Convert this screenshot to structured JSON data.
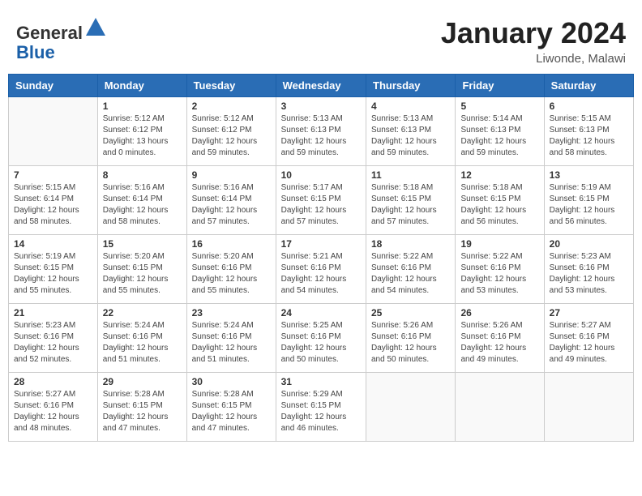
{
  "header": {
    "logo_line1": "General",
    "logo_line2": "Blue",
    "month_year": "January 2024",
    "location": "Liwonde, Malawi"
  },
  "days_of_week": [
    "Sunday",
    "Monday",
    "Tuesday",
    "Wednesday",
    "Thursday",
    "Friday",
    "Saturday"
  ],
  "weeks": [
    [
      {
        "day": "",
        "info": ""
      },
      {
        "day": "1",
        "info": "Sunrise: 5:12 AM\nSunset: 6:12 PM\nDaylight: 13 hours\nand 0 minutes."
      },
      {
        "day": "2",
        "info": "Sunrise: 5:12 AM\nSunset: 6:12 PM\nDaylight: 12 hours\nand 59 minutes."
      },
      {
        "day": "3",
        "info": "Sunrise: 5:13 AM\nSunset: 6:13 PM\nDaylight: 12 hours\nand 59 minutes."
      },
      {
        "day": "4",
        "info": "Sunrise: 5:13 AM\nSunset: 6:13 PM\nDaylight: 12 hours\nand 59 minutes."
      },
      {
        "day": "5",
        "info": "Sunrise: 5:14 AM\nSunset: 6:13 PM\nDaylight: 12 hours\nand 59 minutes."
      },
      {
        "day": "6",
        "info": "Sunrise: 5:15 AM\nSunset: 6:13 PM\nDaylight: 12 hours\nand 58 minutes."
      }
    ],
    [
      {
        "day": "7",
        "info": "Sunrise: 5:15 AM\nSunset: 6:14 PM\nDaylight: 12 hours\nand 58 minutes."
      },
      {
        "day": "8",
        "info": "Sunrise: 5:16 AM\nSunset: 6:14 PM\nDaylight: 12 hours\nand 58 minutes."
      },
      {
        "day": "9",
        "info": "Sunrise: 5:16 AM\nSunset: 6:14 PM\nDaylight: 12 hours\nand 57 minutes."
      },
      {
        "day": "10",
        "info": "Sunrise: 5:17 AM\nSunset: 6:15 PM\nDaylight: 12 hours\nand 57 minutes."
      },
      {
        "day": "11",
        "info": "Sunrise: 5:18 AM\nSunset: 6:15 PM\nDaylight: 12 hours\nand 57 minutes."
      },
      {
        "day": "12",
        "info": "Sunrise: 5:18 AM\nSunset: 6:15 PM\nDaylight: 12 hours\nand 56 minutes."
      },
      {
        "day": "13",
        "info": "Sunrise: 5:19 AM\nSunset: 6:15 PM\nDaylight: 12 hours\nand 56 minutes."
      }
    ],
    [
      {
        "day": "14",
        "info": "Sunrise: 5:19 AM\nSunset: 6:15 PM\nDaylight: 12 hours\nand 55 minutes."
      },
      {
        "day": "15",
        "info": "Sunrise: 5:20 AM\nSunset: 6:15 PM\nDaylight: 12 hours\nand 55 minutes."
      },
      {
        "day": "16",
        "info": "Sunrise: 5:20 AM\nSunset: 6:16 PM\nDaylight: 12 hours\nand 55 minutes."
      },
      {
        "day": "17",
        "info": "Sunrise: 5:21 AM\nSunset: 6:16 PM\nDaylight: 12 hours\nand 54 minutes."
      },
      {
        "day": "18",
        "info": "Sunrise: 5:22 AM\nSunset: 6:16 PM\nDaylight: 12 hours\nand 54 minutes."
      },
      {
        "day": "19",
        "info": "Sunrise: 5:22 AM\nSunset: 6:16 PM\nDaylight: 12 hours\nand 53 minutes."
      },
      {
        "day": "20",
        "info": "Sunrise: 5:23 AM\nSunset: 6:16 PM\nDaylight: 12 hours\nand 53 minutes."
      }
    ],
    [
      {
        "day": "21",
        "info": "Sunrise: 5:23 AM\nSunset: 6:16 PM\nDaylight: 12 hours\nand 52 minutes."
      },
      {
        "day": "22",
        "info": "Sunrise: 5:24 AM\nSunset: 6:16 PM\nDaylight: 12 hours\nand 51 minutes."
      },
      {
        "day": "23",
        "info": "Sunrise: 5:24 AM\nSunset: 6:16 PM\nDaylight: 12 hours\nand 51 minutes."
      },
      {
        "day": "24",
        "info": "Sunrise: 5:25 AM\nSunset: 6:16 PM\nDaylight: 12 hours\nand 50 minutes."
      },
      {
        "day": "25",
        "info": "Sunrise: 5:26 AM\nSunset: 6:16 PM\nDaylight: 12 hours\nand 50 minutes."
      },
      {
        "day": "26",
        "info": "Sunrise: 5:26 AM\nSunset: 6:16 PM\nDaylight: 12 hours\nand 49 minutes."
      },
      {
        "day": "27",
        "info": "Sunrise: 5:27 AM\nSunset: 6:16 PM\nDaylight: 12 hours\nand 49 minutes."
      }
    ],
    [
      {
        "day": "28",
        "info": "Sunrise: 5:27 AM\nSunset: 6:16 PM\nDaylight: 12 hours\nand 48 minutes."
      },
      {
        "day": "29",
        "info": "Sunrise: 5:28 AM\nSunset: 6:15 PM\nDaylight: 12 hours\nand 47 minutes."
      },
      {
        "day": "30",
        "info": "Sunrise: 5:28 AM\nSunset: 6:15 PM\nDaylight: 12 hours\nand 47 minutes."
      },
      {
        "day": "31",
        "info": "Sunrise: 5:29 AM\nSunset: 6:15 PM\nDaylight: 12 hours\nand 46 minutes."
      },
      {
        "day": "",
        "info": ""
      },
      {
        "day": "",
        "info": ""
      },
      {
        "day": "",
        "info": ""
      }
    ]
  ]
}
